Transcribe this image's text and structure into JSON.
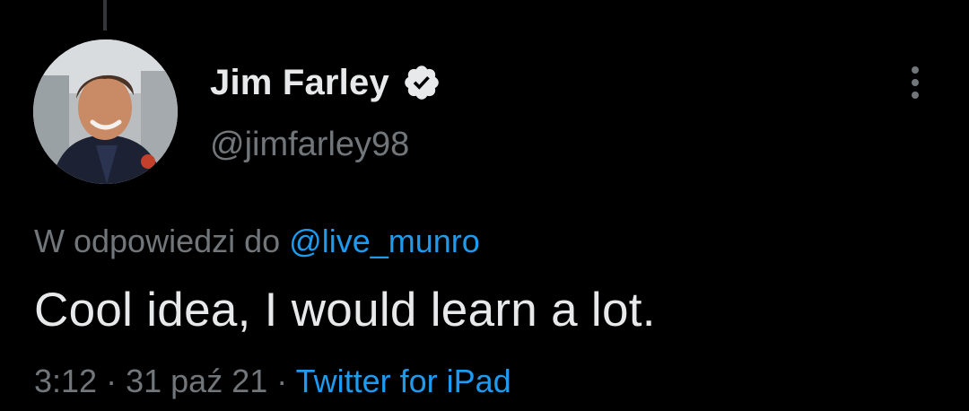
{
  "tweet": {
    "author": {
      "display_name": "Jim Farley",
      "handle": "@jimfarley98",
      "verified": true,
      "avatar_icon": "profile-photo"
    },
    "reply_to": {
      "prefix": "W odpowiedzi do",
      "mention": "@live_munro"
    },
    "text": "Cool idea, I would learn a lot.",
    "meta": {
      "time": "3:12",
      "separator": "·",
      "date": "31 paź 21",
      "source": "Twitter for iPad"
    },
    "more_icon": "more-vertical-icon"
  },
  "colors": {
    "background": "#000000",
    "primary_text": "#e7e9ea",
    "secondary_text": "#71767b",
    "accent": "#1d9bf0",
    "thread_line": "#333639"
  }
}
